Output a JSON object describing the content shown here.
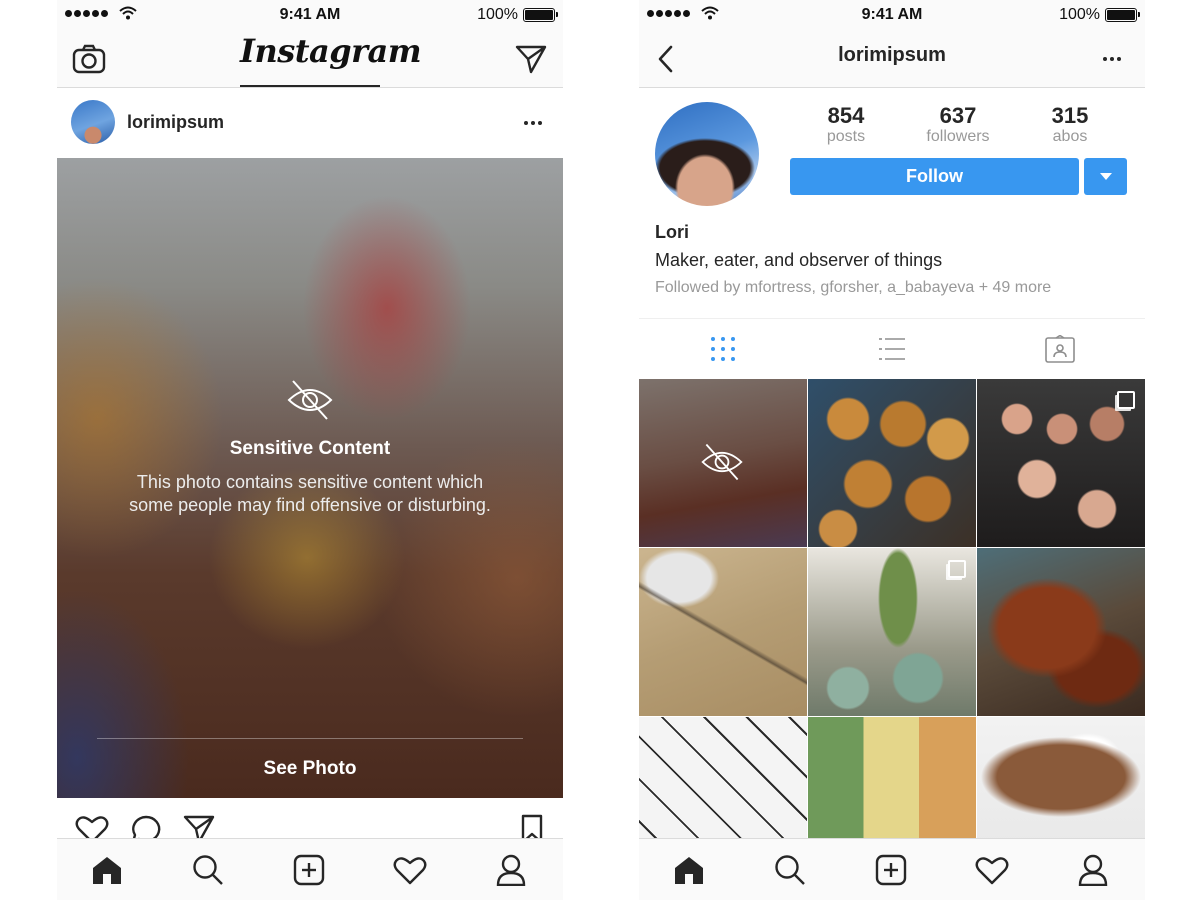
{
  "status": {
    "time": "9:41 AM",
    "battery": "100%"
  },
  "left": {
    "app_title": "Instagram",
    "post": {
      "username": "lorimipsum",
      "sensitive_title": "Sensitive Content",
      "sensitive_desc_line1": "This photo contains sensitive content which",
      "sensitive_desc_line2": "some people may find offensive or disturbing.",
      "see_photo": "See Photo"
    }
  },
  "right": {
    "nav_title": "lorimipsum",
    "stats": [
      {
        "value": "854",
        "label": "posts"
      },
      {
        "value": "637",
        "label": "followers"
      },
      {
        "value": "315",
        "label": "abos"
      }
    ],
    "follow_label": "Follow",
    "name": "Lori",
    "bio": "Maker, eater, and observer of things",
    "followed_by": "Followed by mfortress, gforsher, a_babayeva + 49 more"
  },
  "colors": {
    "accent": "#3897f0",
    "text": "#262626",
    "muted": "#999999"
  },
  "icons": {
    "nav_left": [
      "camera-icon",
      "paper-plane-icon"
    ],
    "post_actions": [
      "heart-icon",
      "comment-icon",
      "share-icon",
      "bookmark-icon"
    ],
    "tabbar": [
      "home-icon",
      "search-icon",
      "add-icon",
      "heart-icon",
      "profile-icon"
    ],
    "profile_views": [
      "grid-view-icon",
      "list-view-icon",
      "tagged-icon"
    ]
  }
}
